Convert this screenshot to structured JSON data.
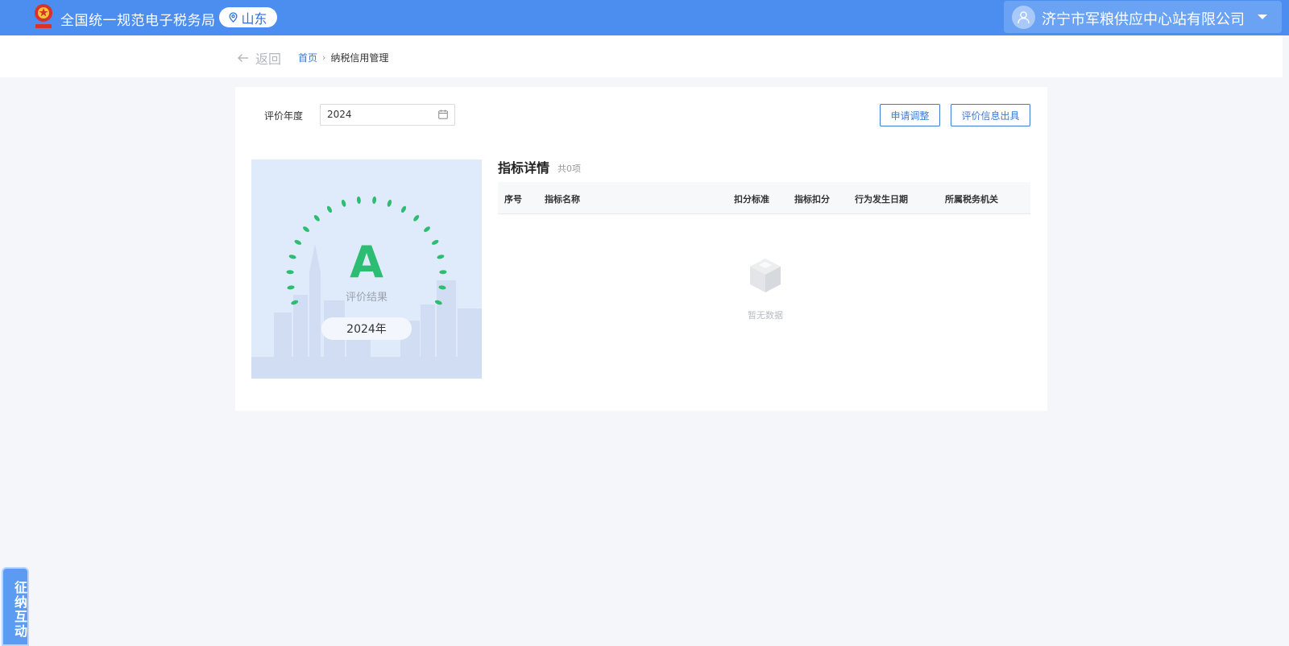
{
  "header": {
    "site_title": "全国统一规范电子税务局",
    "region": "山东",
    "company": "济宁市军粮供应中心站有限公司"
  },
  "nav": {
    "back_label": "返回",
    "breadcrumb_home": "首页",
    "breadcrumb_current": "纳税信用管理"
  },
  "filter": {
    "year_label": "评价年度",
    "year_value": "2024"
  },
  "actions": {
    "adjust_label": "申请调整",
    "issue_label": "评价信息出具"
  },
  "result": {
    "grade": "A",
    "caption": "评价结果",
    "year_tag": "2024年",
    "grade_color": "#2cbd72"
  },
  "detail": {
    "title": "指标详情",
    "count": "共0项",
    "columns": [
      "序号",
      "指标名称",
      "扣分标准",
      "指标扣分",
      "行为发生日期",
      "所属税务机关"
    ],
    "rows": [],
    "empty_text": "暂无数据"
  },
  "side_tab": {
    "label": "征纳互动"
  },
  "colors": {
    "header_bg": "#4b8ef0",
    "accent": "#3f7ad4"
  }
}
